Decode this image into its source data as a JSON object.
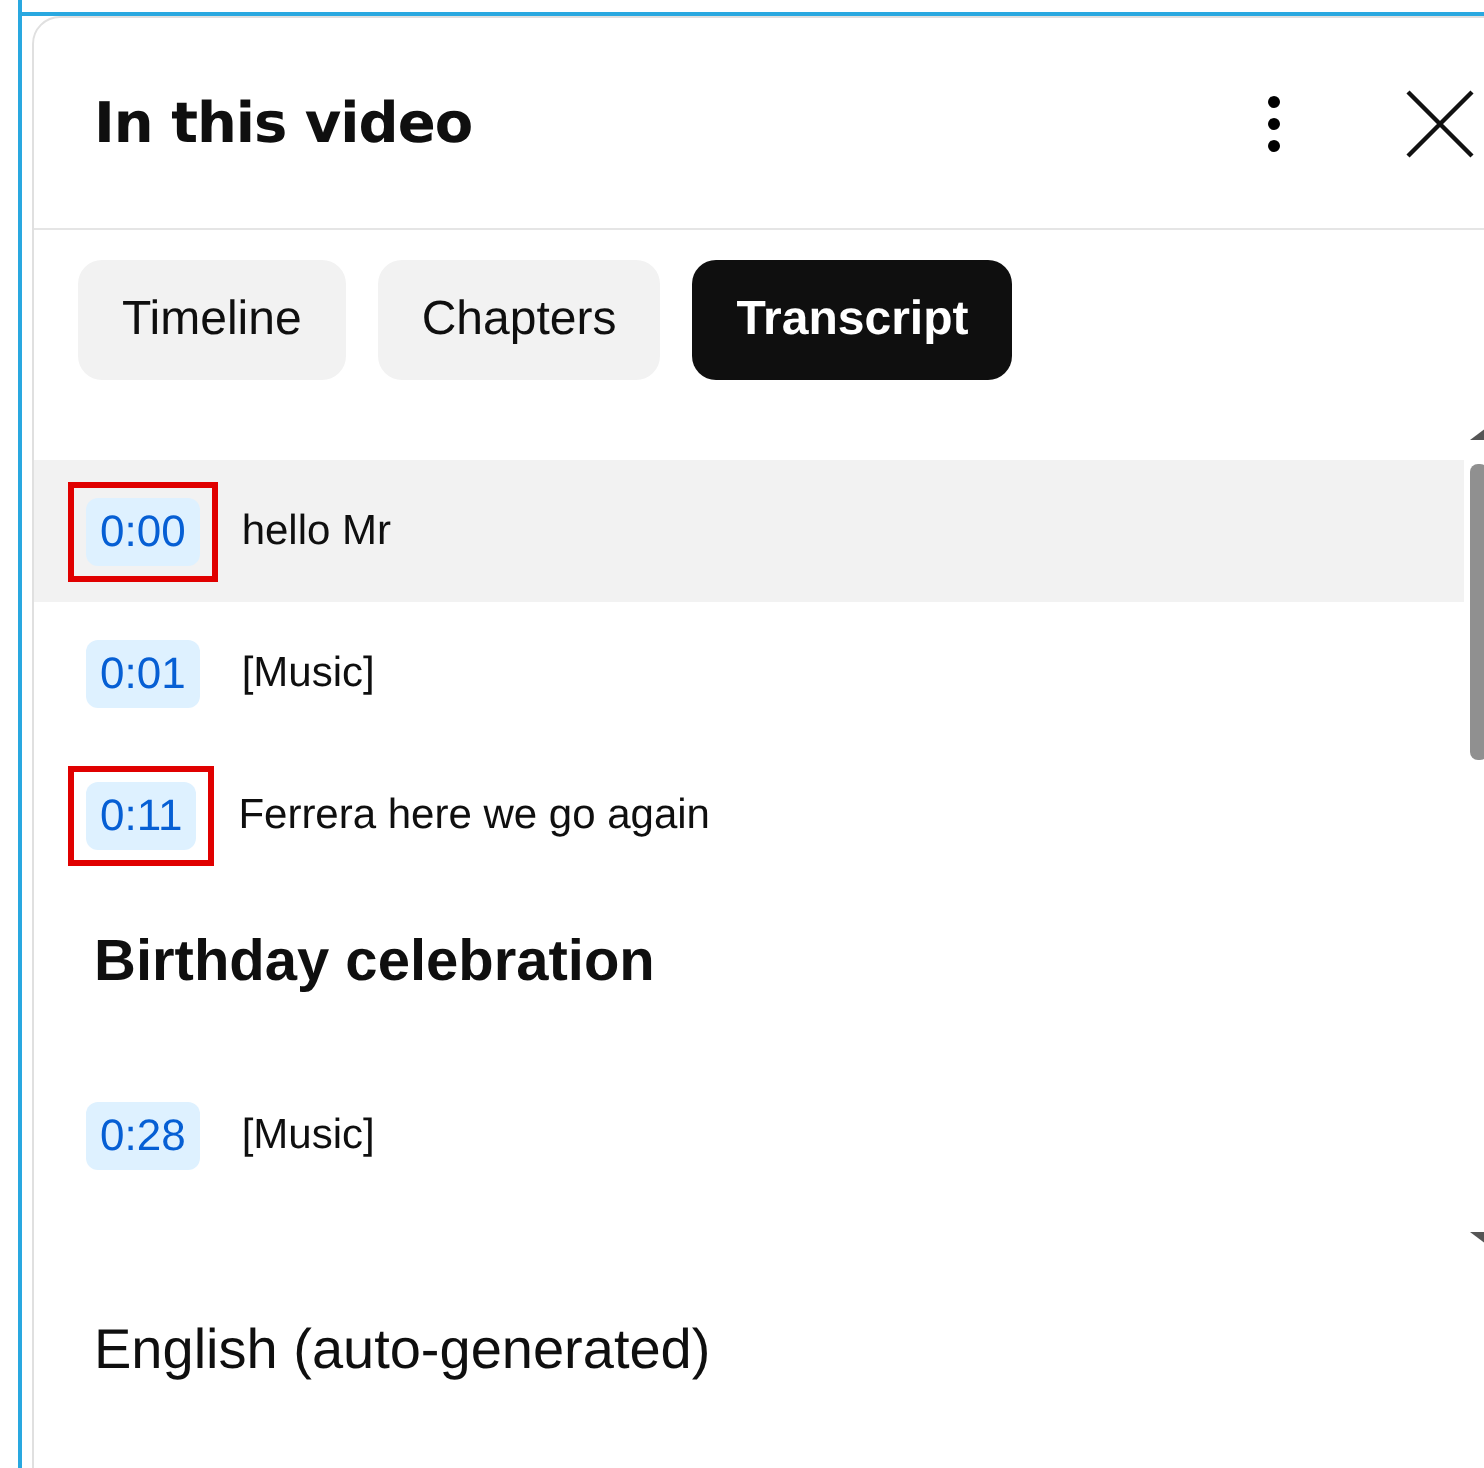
{
  "panel": {
    "title": "In this video"
  },
  "tabs": [
    {
      "label": "Timeline",
      "selected": false
    },
    {
      "label": "Chapters",
      "selected": false
    },
    {
      "label": "Transcript",
      "selected": true
    }
  ],
  "transcript": [
    {
      "kind": "segment",
      "time": "0:00",
      "text": "hello Mr",
      "highlighted": true,
      "outlined": true
    },
    {
      "kind": "segment",
      "time": "0:01",
      "text": "[Music]",
      "highlighted": false,
      "outlined": false
    },
    {
      "kind": "segment",
      "time": "0:11",
      "text": "Ferrera here we go again",
      "highlighted": false,
      "outlined": true
    },
    {
      "kind": "chapter",
      "text": "Birthday celebration"
    },
    {
      "kind": "segment",
      "time": "0:28",
      "text": "[Music]",
      "highlighted": false,
      "outlined": false
    }
  ],
  "footer": {
    "language": "English (auto-generated)"
  }
}
